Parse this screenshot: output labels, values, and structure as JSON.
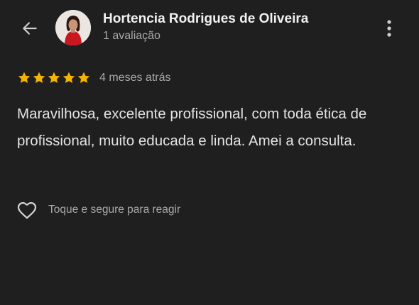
{
  "header": {
    "back_icon": "arrow-left-icon",
    "reviewer_name": "Hortencia Rodrigues de Oliveira",
    "review_count": "1 avaliação",
    "more_icon": "more-vertical-icon"
  },
  "review": {
    "rating": 5,
    "rating_max": 5,
    "star_color": "#f4b400",
    "date": "4 meses atrás",
    "text": "Maravilhosa, excelente profissional, com toda ética de profissional, muito educada e linda. Amei a consulta."
  },
  "reaction": {
    "icon": "heart-outline-icon",
    "label": "Toque e segure para reagir"
  },
  "colors": {
    "background": "#1f1f1f",
    "primary_text": "#f1f1f1",
    "secondary_text": "#a9a9a9"
  }
}
